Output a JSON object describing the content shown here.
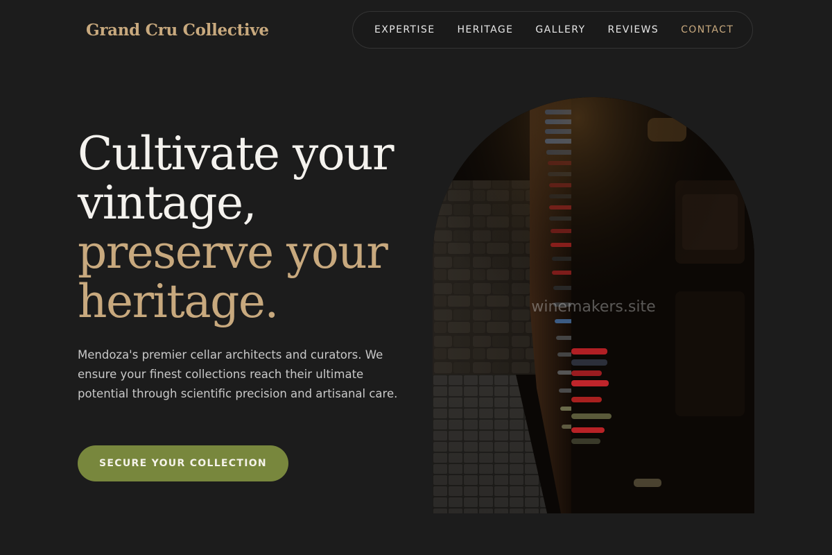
{
  "brand": {
    "name": "Grand Cru Collective",
    "accent_color": "#c8a97e",
    "button_color": "#78873d",
    "background_color": "#1c1c1c"
  },
  "nav": {
    "items": [
      {
        "label": "EXPERTISE"
      },
      {
        "label": "HERITAGE"
      },
      {
        "label": "GALLERY"
      },
      {
        "label": "REVIEWS"
      },
      {
        "label": "CONTACT",
        "highlighted": true
      }
    ]
  },
  "hero": {
    "headline_line1": "Cultivate your",
    "headline_line2": "vintage,",
    "headline_accent_line1": "preserve your",
    "headline_accent_line2": "heritage.",
    "description": "Mendoza's premier cellar architects and curators. We ensure your finest collections reach their ultimate potential through scientific precision and artisanal care.",
    "cta_label": "SECURE YOUR COLLECTION"
  },
  "image": {
    "subject": "wine-cellar-racks-photo",
    "watermark": "winemakers.site"
  }
}
